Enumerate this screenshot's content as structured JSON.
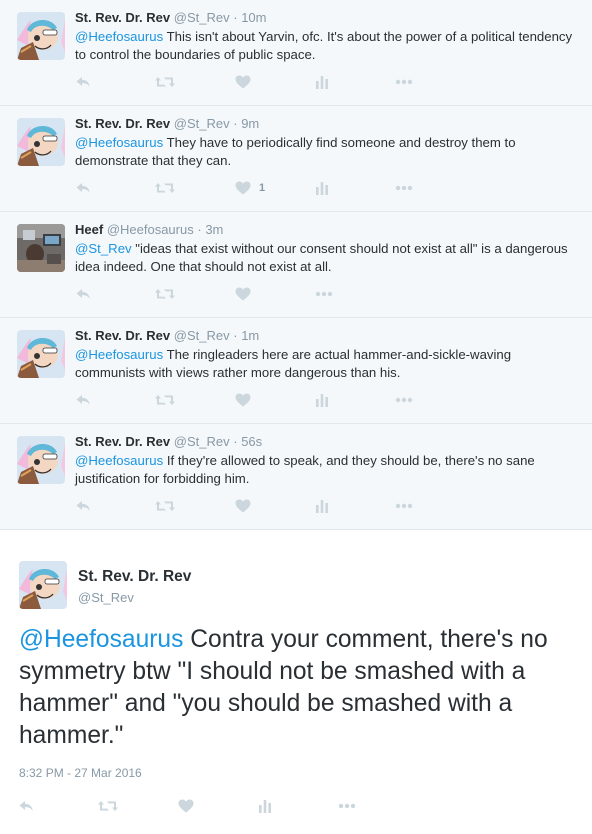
{
  "thread": [
    {
      "name": "St. Rev. Dr. Rev",
      "handle": "@St_Rev",
      "time": "10m",
      "mention": "@Heefosaurus",
      "text": " This isn't about Yarvin, ofc. It's about the power of a political tendency to control the boundaries of public space.",
      "like_count": ""
    },
    {
      "name": "St. Rev. Dr. Rev",
      "handle": "@St_Rev",
      "time": "9m",
      "mention": "@Heefosaurus",
      "text": " They have to periodically find someone and destroy them to demonstrate that they can.",
      "like_count": "1"
    },
    {
      "name": "Heef",
      "handle": "@Heefosaurus",
      "time": "3m",
      "mention": "@St_Rev",
      "text": " \"ideas that exist without our consent should not exist at all\" is a dangerous idea indeed. One that should not exist at all.",
      "like_count": ""
    },
    {
      "name": "St. Rev. Dr. Rev",
      "handle": "@St_Rev",
      "time": "1m",
      "mention": "@Heefosaurus",
      "text": " The ringleaders here are actual hammer-and-sickle-waving communists with views rather more dangerous than his.",
      "like_count": ""
    },
    {
      "name": "St. Rev. Dr. Rev",
      "handle": "@St_Rev",
      "time": "56s",
      "mention": "@Heefosaurus",
      "text": " If they're allowed to speak, and they should be, there's no sane justification for forbidding him.",
      "like_count": ""
    }
  ],
  "main": {
    "name": "St. Rev. Dr. Rev",
    "handle": "@St_Rev",
    "mention": "@Heefosaurus",
    "text": " Contra your comment, there's no symmetry btw \"I should not be smashed with a hammer\" and \"you should be smashed with a hammer.\"",
    "timestamp": "8:32 PM - 27 Mar 2016"
  },
  "icons": {
    "reply": "reply-icon",
    "retweet": "retweet-icon",
    "like": "heart-icon",
    "analytics": "analytics-icon",
    "more": "more-icon"
  },
  "colors": {
    "link": "#1b95e0",
    "muted": "#8899a6",
    "icon": "#ccd6dd",
    "thread_bg": "#f5f8fa"
  }
}
